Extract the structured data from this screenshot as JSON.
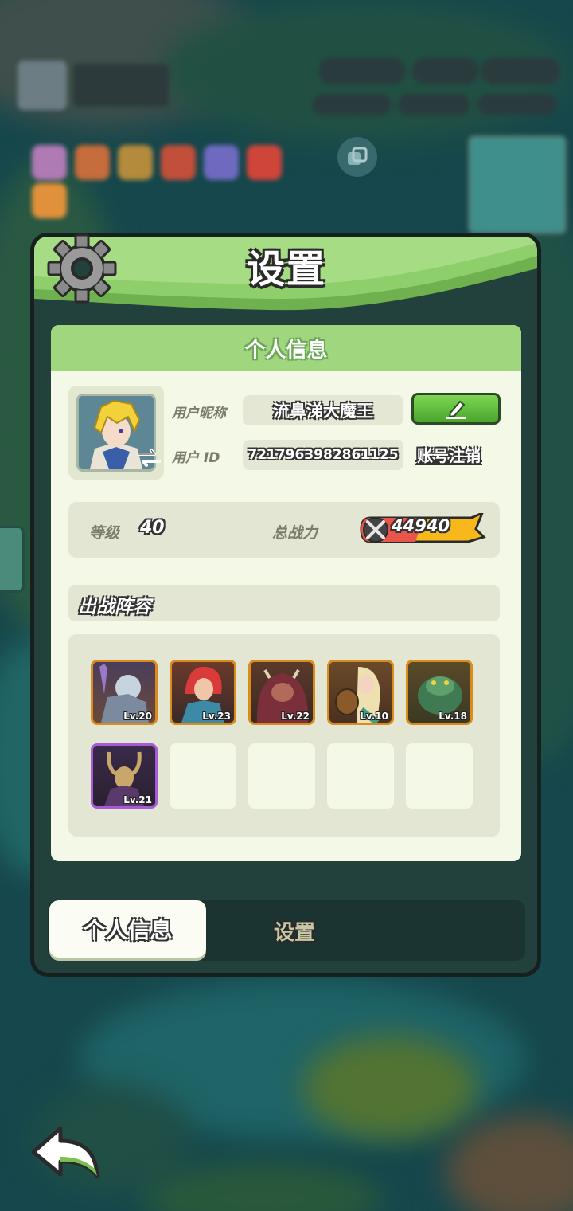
{
  "panel": {
    "title": "设置",
    "section_title": "个人信息"
  },
  "profile": {
    "nickname_label": "用户昵称",
    "nickname": "流鼻涕大魔王",
    "id_label": "用户 ID",
    "user_id": "7217963982861125",
    "cancel_account_label": "账号注销"
  },
  "stats": {
    "level_label": "等级",
    "level": "40",
    "power_label": "总战力",
    "power": "44940"
  },
  "lineup": {
    "title": "出战阵容",
    "heroes": [
      {
        "level_text": "Lv.20",
        "frame": "orange"
      },
      {
        "level_text": "Lv.23",
        "frame": "orange"
      },
      {
        "level_text": "Lv.22",
        "frame": "orange"
      },
      {
        "level_text": "Lv.10",
        "frame": "orange"
      },
      {
        "level_text": "Lv.18",
        "frame": "orange"
      },
      {
        "level_text": "Lv.21",
        "frame": "purple"
      }
    ],
    "empty_slots": 4
  },
  "tabs": {
    "active": "个人信息",
    "inactive": "设置"
  },
  "colors": {
    "header_green": "#9fd67e",
    "content_bg": "#f4f8e6",
    "edit_button": "#5fbd3a",
    "panel_border": "#16201f"
  },
  "icons": [
    "gear-icon",
    "pencil-icon",
    "swap-icon",
    "sword-icon",
    "back-arrow-icon",
    "layers-icon"
  ]
}
